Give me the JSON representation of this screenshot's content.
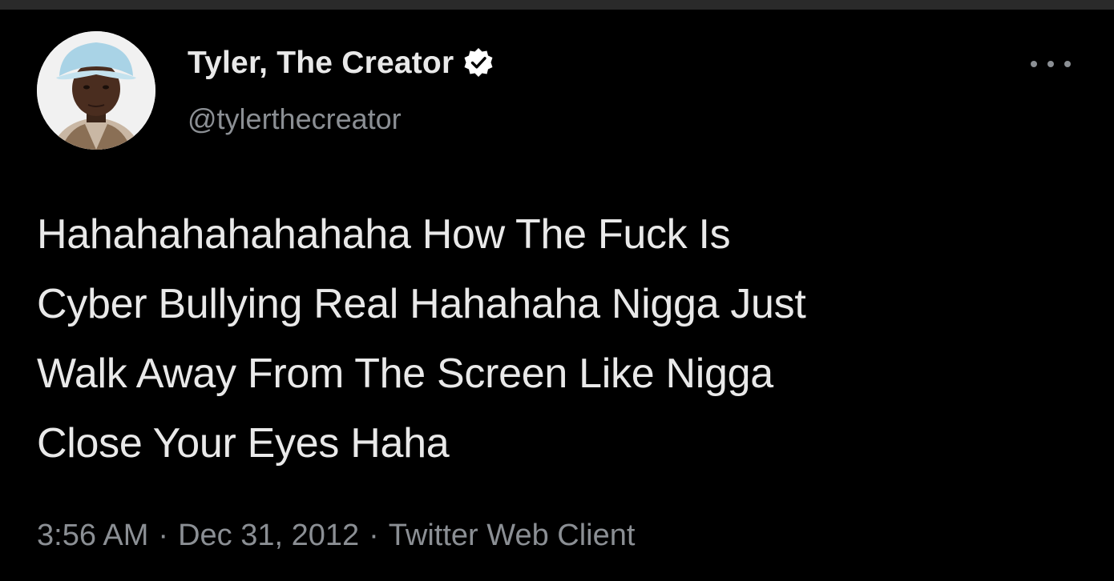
{
  "tweet": {
    "display_name": "Tyler, The Creator",
    "verified": true,
    "handle": "@tylerthecreator",
    "text_lines": [
      "Hahahahahahahaha How The Fuck Is",
      "Cyber Bullying Real Hahahaha Nigga Just",
      "Walk Away From The Screen Like Nigga",
      "Close Your Eyes Haha"
    ],
    "time": "3:56 AM",
    "date": "Dec 31, 2012",
    "source": "Twitter Web Client",
    "separator": "·"
  },
  "icons": {
    "avatar": "profile-avatar",
    "verified": "verified-badge-icon",
    "more": "more-options-icon"
  },
  "colors": {
    "background": "#000000",
    "primary_text": "#e9e9e9",
    "secondary_text": "#8b8f94",
    "verified_badge": "#ffffff"
  }
}
